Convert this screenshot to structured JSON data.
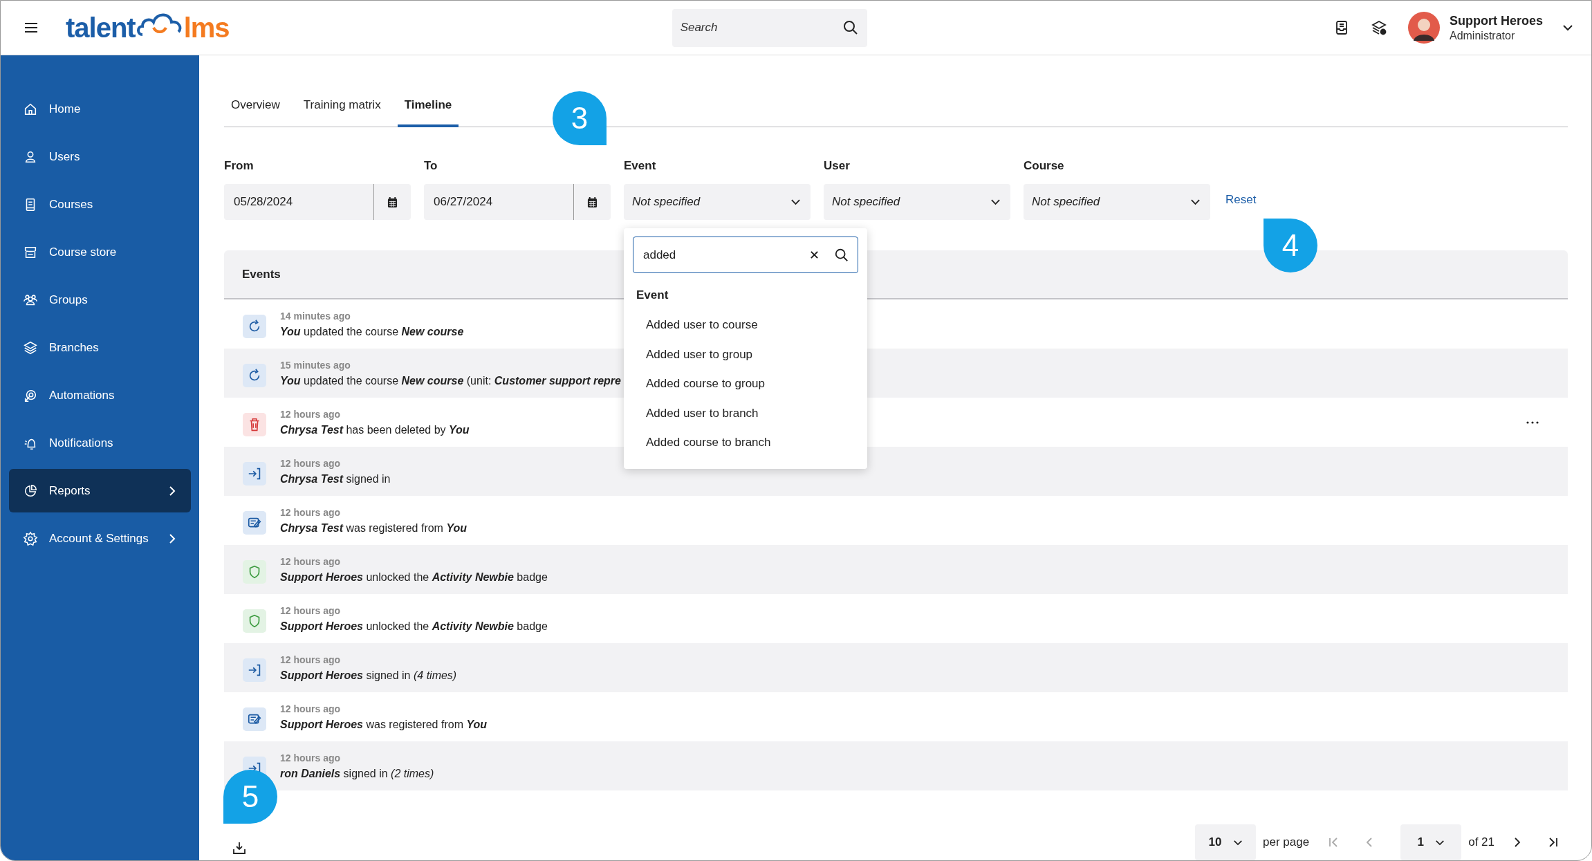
{
  "top_bar": {
    "logo": {
      "text_1": "talent",
      "text_2": "lms"
    },
    "search": {
      "placeholder": "Search"
    },
    "user": {
      "name": "Support Heroes",
      "role": "Administrator"
    }
  },
  "sidebar": {
    "items": [
      {
        "label": "Home",
        "selected": false,
        "has_submenu": false
      },
      {
        "label": "Users",
        "selected": false,
        "has_submenu": false
      },
      {
        "label": "Courses",
        "selected": false,
        "has_submenu": false
      },
      {
        "label": "Course store",
        "selected": false,
        "has_submenu": false
      },
      {
        "label": "Groups",
        "selected": false,
        "has_submenu": false
      },
      {
        "label": "Branches",
        "selected": false,
        "has_submenu": false
      },
      {
        "label": "Automations",
        "selected": false,
        "has_submenu": false
      },
      {
        "label": "Notifications",
        "selected": false,
        "has_submenu": false
      },
      {
        "label": "Reports",
        "selected": true,
        "has_submenu": true
      },
      {
        "label": "Account & Settings",
        "selected": false,
        "has_submenu": true
      }
    ]
  },
  "tabs": [
    {
      "label": "Overview",
      "selected": false
    },
    {
      "label": "Training matrix",
      "selected": false
    },
    {
      "label": "Timeline",
      "selected": true
    }
  ],
  "filters": {
    "from": {
      "label": "From",
      "value": "05/28/2024"
    },
    "to": {
      "label": "To",
      "value": "06/27/2024"
    },
    "selects": [
      {
        "label": "Event",
        "value": "Not specified"
      },
      {
        "label": "User",
        "value": "Not specified"
      },
      {
        "label": "Course",
        "value": "Not specified"
      }
    ],
    "reset": "Reset"
  },
  "event_dropdown": {
    "search_value": "added",
    "group_label": "Event",
    "options": [
      "Added user to course",
      "Added user to group",
      "Added course to group",
      "Added user to branch",
      "Added course to branch"
    ]
  },
  "events": {
    "title": "Events",
    "rows": [
      {
        "kind": "update",
        "time": "14 minutes ago",
        "text": "**You** updated the course **New course**",
        "has_menu": false
      },
      {
        "kind": "update",
        "time": "15 minutes ago",
        "text": "**You** updated the course **New course** (unit: **Customer support repre**",
        "has_menu": false
      },
      {
        "kind": "delete",
        "time": "12 hours ago",
        "text": "**Chrysa Test** has been deleted by **You**",
        "has_menu": true
      },
      {
        "kind": "signin",
        "time": "12 hours ago",
        "text": "**Chrysa Test** signed in",
        "has_menu": false
      },
      {
        "kind": "register",
        "time": "12 hours ago",
        "text": "**Chrysa Test** was registered from **You**",
        "has_menu": false
      },
      {
        "kind": "badge",
        "time": "12 hours ago",
        "text": "**Support Heroes** unlocked the **Activity Newbie** badge",
        "has_menu": false
      },
      {
        "kind": "badge",
        "time": "12 hours ago",
        "text": "**Support Heroes** unlocked the **Activity Newbie** badge",
        "has_menu": false
      },
      {
        "kind": "signin",
        "time": "12 hours ago",
        "text": "**Support Heroes** signed in *(4 times)*",
        "has_menu": false
      },
      {
        "kind": "register",
        "time": "12 hours ago",
        "text": "**Support Heroes** was registered from **You**",
        "has_menu": false
      },
      {
        "kind": "signin",
        "time": "12 hours ago",
        "text": "**ron Daniels** signed in *(2 times)*",
        "has_menu": false
      }
    ]
  },
  "pagination": {
    "per_page_value": "10",
    "per_page_label": "per page",
    "page": "1",
    "page_count": "of 21"
  },
  "callouts": [
    {
      "label": "3"
    },
    {
      "label": "4"
    },
    {
      "label": "5"
    }
  ]
}
